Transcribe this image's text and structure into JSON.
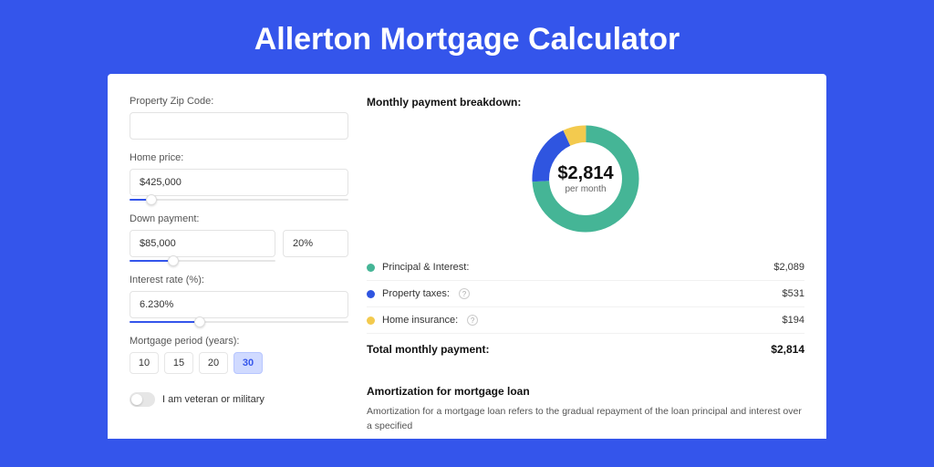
{
  "title": "Allerton Mortgage Calculator",
  "form": {
    "zip_label": "Property Zip Code:",
    "zip_value": "",
    "home_price_label": "Home price:",
    "home_price_value": "$425,000",
    "down_payment_label": "Down payment:",
    "down_payment_value": "$85,000",
    "down_payment_pct": "20%",
    "interest_label": "Interest rate (%):",
    "interest_value": "6.230%",
    "period_label": "Mortgage period (years):",
    "periods": {
      "p10": "10",
      "p15": "15",
      "p20": "20",
      "p30": "30"
    },
    "veteran_label": "I am veteran or military"
  },
  "breakdown": {
    "title": "Monthly payment breakdown:",
    "donut_amount": "$2,814",
    "donut_sub": "per month",
    "rows": {
      "pi_label": "Principal & Interest:",
      "pi_amount": "$2,089",
      "tax_label": "Property taxes:",
      "tax_amount": "$531",
      "ins_label": "Home insurance:",
      "ins_amount": "$194"
    },
    "total_label": "Total monthly payment:",
    "total_amount": "$2,814"
  },
  "amort": {
    "title": "Amortization for mortgage loan",
    "text": "Amortization for a mortgage loan refers to the gradual repayment of the loan principal and interest over a specified"
  },
  "chart_data": {
    "type": "pie",
    "title": "Monthly payment breakdown",
    "series": [
      {
        "name": "Principal & Interest",
        "value": 2089,
        "color": "#45b596"
      },
      {
        "name": "Property taxes",
        "value": 531,
        "color": "#2f55e0"
      },
      {
        "name": "Home insurance",
        "value": 194,
        "color": "#f3ca4e"
      }
    ],
    "total": 2814
  }
}
